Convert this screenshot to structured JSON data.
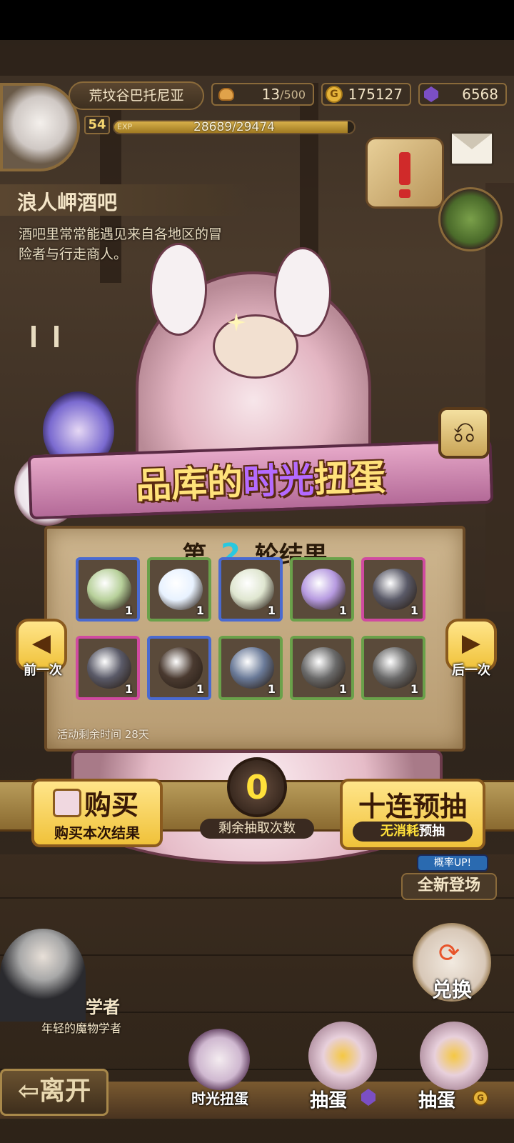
{
  "top_bar": {
    "region_name": "荒坟谷巴托尼亚",
    "stamina": "13",
    "stamina_max": "/500",
    "gold": "175127",
    "gems": "6568",
    "level": "54",
    "exp_label": "EXP",
    "exp_value": "28689/29474",
    "exp_progress": 0.973
  },
  "location": {
    "title": "浪人岬酒吧",
    "description_line1": "酒吧里常常能遇见来自各地区的冒",
    "description_line2": "险者与行走商人。"
  },
  "event": {
    "title_part1": "品库的",
    "title_highlight": "时光",
    "title_part2": "扭蛋",
    "round_prefix": "第",
    "round_number": "2",
    "round_suffix": "轮结果",
    "remaining_time": "活动剩余时间  28天",
    "prev_label": "前一次",
    "next_label": "后一次",
    "remaining_draws": "0",
    "remaining_draws_label": "剩余抽取次数"
  },
  "results": [
    {
      "name": "green-leaf-item",
      "qty": "1",
      "rarity": "blue",
      "color": "#b7d09a"
    },
    {
      "name": "cloud-planet-item",
      "qty": "1",
      "rarity": "green",
      "color": "#e8f2ff"
    },
    {
      "name": "spotted-egg-item",
      "qty": "1",
      "rarity": "blue",
      "color": "#dfe6d0"
    },
    {
      "name": "purple-bud-item",
      "qty": "1",
      "rarity": "green",
      "color": "#b69ae0"
    },
    {
      "name": "horned-helmet-item",
      "qty": "1",
      "rarity": "pink",
      "color": "#5a5a68"
    },
    {
      "name": "horned-helmet-item",
      "qty": "1",
      "rarity": "pink",
      "color": "#5a5a68"
    },
    {
      "name": "dark-armor-item",
      "qty": "1",
      "rarity": "blue",
      "color": "#4a3a30"
    },
    {
      "name": "shell-item",
      "qty": "1",
      "rarity": "green",
      "color": "#6a7a98"
    },
    {
      "name": "stone-gauntlet-item",
      "qty": "1",
      "rarity": "green",
      "color": "#6a6a6a"
    },
    {
      "name": "stone-gauntlet-item",
      "qty": "1",
      "rarity": "green",
      "color": "#6a6a6a"
    }
  ],
  "buy_button": {
    "title": "购买",
    "subtitle": "购买本次结果"
  },
  "ten_draw_button": {
    "title": "十连预抽",
    "subtitle_highlight": "无消耗",
    "subtitle": "预抽"
  },
  "side": {
    "rate_up": "概率UP!",
    "new_arrival": "全新登场",
    "exchange": "兑换"
  },
  "npc": {
    "name": "学者",
    "desc": "年轻的魔物学者"
  },
  "bottom": {
    "leave": "离开",
    "time_gacha": "时光扭蛋",
    "egg_gems": "抽蛋",
    "egg_gold": "抽蛋"
  },
  "colors": {
    "accent": "#f5c542",
    "rate_cyan": "#28c8e0",
    "title_purple": "#8a3ad8"
  }
}
